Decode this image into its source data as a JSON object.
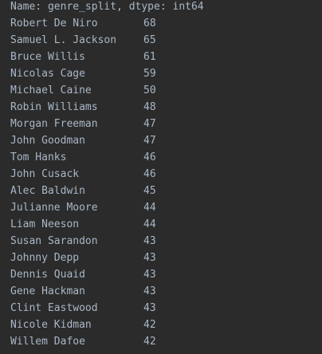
{
  "console": {
    "header": "Name: genre_split, dtype: int64",
    "rows": [
      {
        "name": "Robert De Niro",
        "count": "68"
      },
      {
        "name": "Samuel L. Jackson",
        "count": "65"
      },
      {
        "name": "Bruce Willis",
        "count": "61"
      },
      {
        "name": "Nicolas Cage",
        "count": "59"
      },
      {
        "name": "Michael Caine",
        "count": "50"
      },
      {
        "name": "Robin Williams",
        "count": "48"
      },
      {
        "name": "Morgan Freeman",
        "count": "47"
      },
      {
        "name": "John Goodman",
        "count": "47"
      },
      {
        "name": "Tom Hanks",
        "count": "46"
      },
      {
        "name": "John Cusack",
        "count": "46"
      },
      {
        "name": "Alec Baldwin",
        "count": "45"
      },
      {
        "name": "Julianne Moore",
        "count": "44"
      },
      {
        "name": "Liam Neeson",
        "count": "44"
      },
      {
        "name": "Susan Sarandon",
        "count": "43"
      },
      {
        "name": "Johnny Depp",
        "count": "43"
      },
      {
        "name": "Dennis Quaid",
        "count": "43"
      },
      {
        "name": "Gene Hackman",
        "count": "43"
      },
      {
        "name": "Clint Eastwood",
        "count": "43"
      },
      {
        "name": "Nicole Kidman",
        "count": "42"
      },
      {
        "name": "Willem Dafoe",
        "count": "42"
      }
    ]
  },
  "colors": {
    "background": "#2b2b2b",
    "text": "#a9b7c6"
  }
}
